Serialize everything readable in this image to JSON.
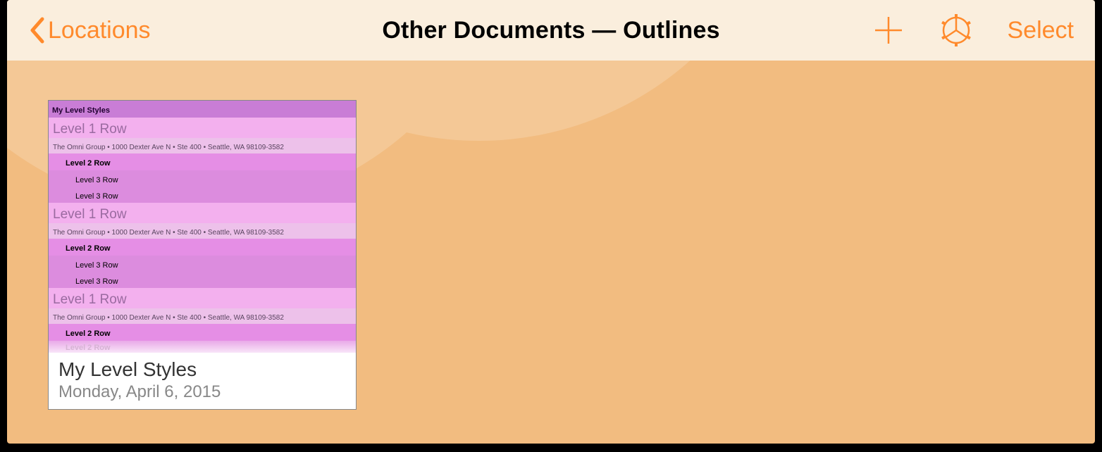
{
  "colors": {
    "accent": "#ff8a2c",
    "toolbar_bg": "#faeedd",
    "content_bg": "#f2bc80"
  },
  "toolbar": {
    "back_label": "Locations",
    "title": "Other Documents — Outlines",
    "select_label": "Select"
  },
  "document": {
    "title": "My Level Styles",
    "date": "Monday, April 6, 2015",
    "preview": {
      "heading": "My Level Styles",
      "note_text": "The Omni Group • 1000 Dexter Ave N • Ste 400 • Seattle, WA 98109-3582",
      "level1_label": "Level 1 Row",
      "level2_label": "Level 2 Row",
      "level3_label": "Level 3 Row"
    }
  }
}
